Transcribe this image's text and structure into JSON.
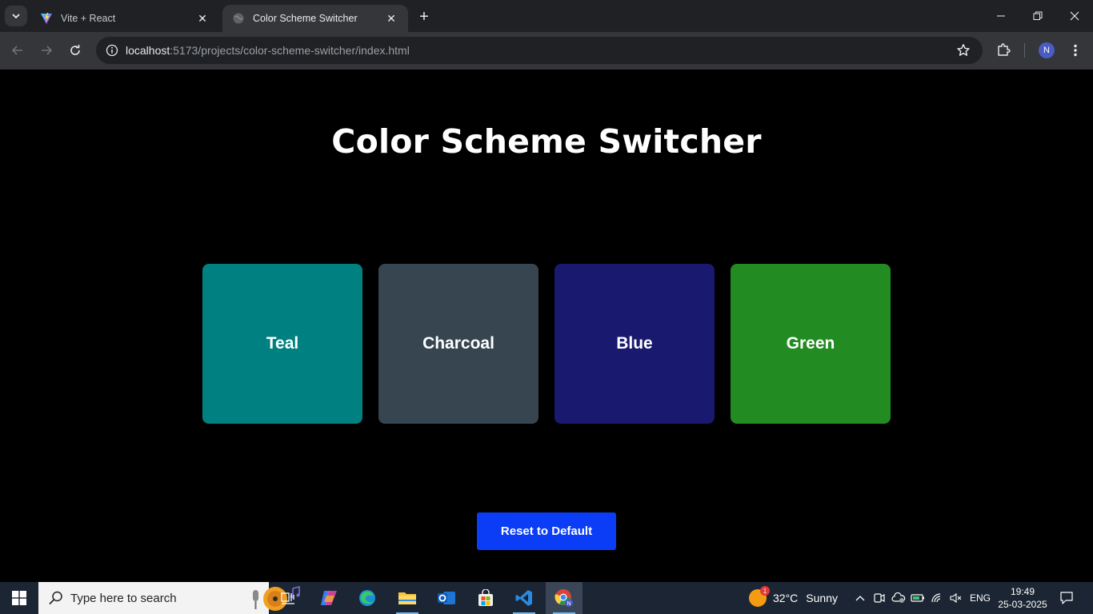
{
  "browser": {
    "tabs": [
      {
        "label": "Vite + React",
        "favicon": "vite-icon",
        "active": false
      },
      {
        "label": "Color Scheme Switcher",
        "favicon": "globe-icon",
        "active": true
      }
    ],
    "url_host": "localhost",
    "url_path": ":5173/projects/color-scheme-switcher/index.html",
    "profile_initial": "N"
  },
  "page": {
    "title": "Color Scheme Switcher",
    "swatches": [
      {
        "label": "Teal",
        "color": "#008080"
      },
      {
        "label": "Charcoal",
        "color": "#36454f"
      },
      {
        "label": "Blue",
        "color": "#191970"
      },
      {
        "label": "Green",
        "color": "#228b22"
      }
    ],
    "reset_label": "Reset to Default",
    "reset_color": "#0a3df5"
  },
  "taskbar": {
    "search_placeholder": "Type here to search",
    "weather_temp": "32°C",
    "weather_condition": "Sunny",
    "weather_badge": "1",
    "language": "ENG",
    "time": "19:49",
    "date": "25-03-2025"
  }
}
